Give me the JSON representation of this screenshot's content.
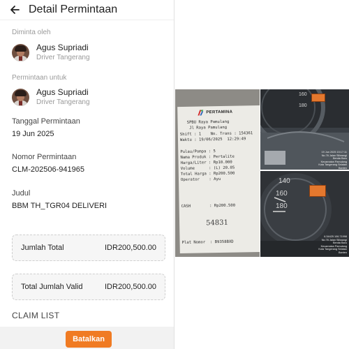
{
  "header": {
    "title": "Detail Permintaan"
  },
  "requested_by": {
    "label": "Diminta oleh",
    "name": "Agus Supriadi",
    "role": "Driver Tangerang"
  },
  "requested_for": {
    "label": "Permintaan untuk",
    "name": "Agus Supriadi",
    "role": "Driver Tangerang"
  },
  "fields": {
    "date_label": "Tanggal Permintaan",
    "date_value": "19 Jun 2025",
    "number_label": "Nomor Permintaan",
    "number_value": "CLM-202506-941965",
    "title_label": "Judul",
    "title_value": "BBM TH_TGR04 DELIVERI"
  },
  "totals": {
    "total_label": "Jumlah Total",
    "total_value": "IDR200,500.00",
    "valid_label": "Total Jumlah Valid",
    "valid_value": "IDR200,500.00"
  },
  "claim_list": {
    "title": "CLAIM LIST"
  },
  "actions": {
    "cancel_label": "Batalkan"
  },
  "receipt": {
    "brand": "PERTAMINA",
    "lines": [
      "   SPBU Raya Pamulang",
      "    Jl Raya Pamulang",
      "Shift : 1    No. Trans : 154361",
      "Waktu : 19/06/2025  12:29:49",
      "Pulau/Pompa : 5",
      "Nama Produk : Pertalite",
      "Harga/Liter : Rp10.000",
      "Volume      : (L) 20.05",
      "Total Harga : Rp200.500",
      "Operator    : Ayu",
      "CASH        : Rp200.500",
      "Plat Nomor  : B9358BXD"
    ],
    "handwritten": "54831"
  },
  "dash_top": {
    "gauge_labels": [
      "160",
      "180"
    ],
    "stamp": "19 Jun 2025 15:17:11\nNo.76 Jalan Siliwangi\nBenda Baru\nKecamatan Pamulang\nKota Tangerang Selatan\nBanten"
  },
  "dash_bottom": {
    "gauge_labels": [
      "140",
      "160",
      "180"
    ],
    "stamp": "6.34425 106.71998\nNo.76 Jalan Siliwangi\nBenda Baru\nKecamatan Pamulang\nKota Tangerang Selatan\nBanten"
  },
  "colors": {
    "accent": "#f07b23",
    "text": "#1f1f1f",
    "muted": "#9a9a9a"
  },
  "icons": {
    "back": "arrow-left-icon",
    "logo": "pertamina-logo-icon"
  }
}
